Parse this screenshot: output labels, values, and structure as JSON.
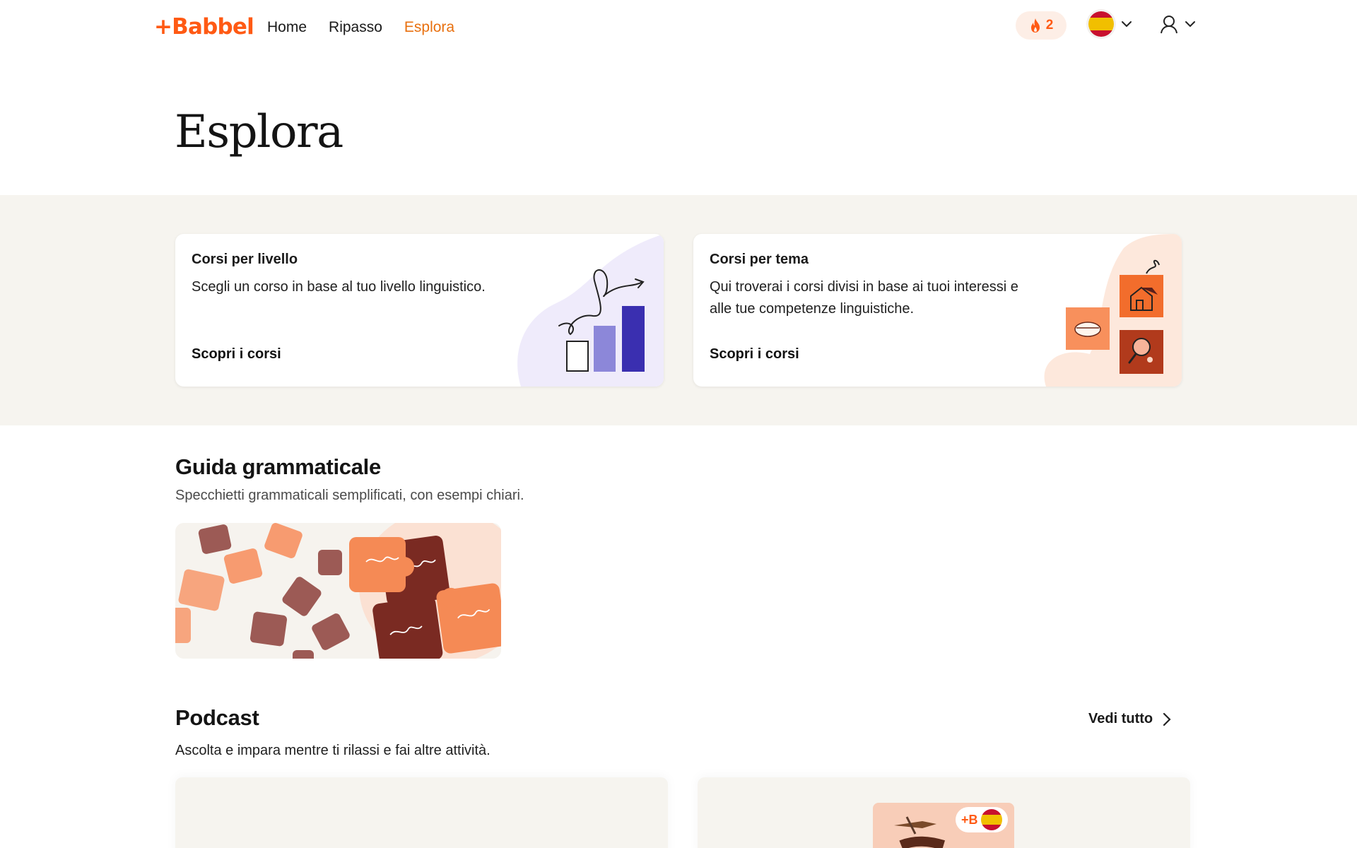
{
  "header": {
    "logo": "+Babbel",
    "nav": [
      {
        "label": "Home",
        "active": false
      },
      {
        "label": "Ripasso",
        "active": false
      },
      {
        "label": "Esplora",
        "active": true
      }
    ],
    "streak_count": "2",
    "language_flag": "spain-flag-icon",
    "accent_color": "#ff5a14"
  },
  "page": {
    "title": "Esplora"
  },
  "cards": [
    {
      "title": "Corsi per livello",
      "description": "Scegli un corso in base al tuo livello linguistico.",
      "cta": "Scopri i corsi"
    },
    {
      "title": "Corsi per tema",
      "description": "Qui troverai i corsi divisi in base ai tuoi interessi e alle tue competenze linguistiche.",
      "cta": "Scopri i corsi"
    }
  ],
  "grammar": {
    "title": "Guida grammaticale",
    "subtitle": "Specchietti grammaticali semplificati, con esempi chiari."
  },
  "podcast": {
    "title": "Podcast",
    "subtitle": "Ascolta e impara mentre ti rilassi e fai altre attività.",
    "see_all": "Vedi tutto",
    "badge": "+B"
  }
}
